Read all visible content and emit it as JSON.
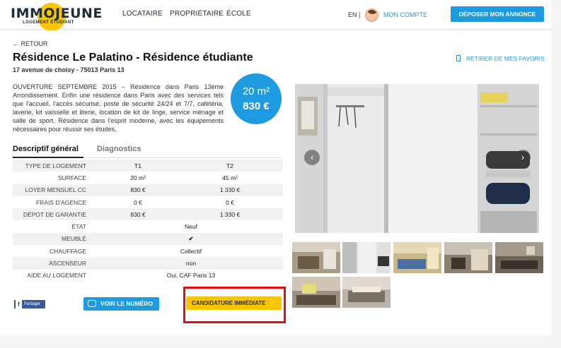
{
  "header": {
    "logo_text": "IMMOJEUNE",
    "logo_subtitle": "LOGEMENT ÉTUDIANT",
    "nav": [
      "LOCATAIRE",
      "PROPRIÉTAIRE",
      "ÉCOLE"
    ],
    "lang": "EN |",
    "account": "MON COMPTE",
    "deposit_button": "DÉPOSER MON ANNONCE"
  },
  "listing": {
    "back": "← RETOUR",
    "title": "Résidence Le Palatino - Résidence étudiante",
    "address": "17 avenue de choisy - 75013 Paris 13",
    "favorite": "RETIRER DE MES FAVORIS",
    "description": "OUVERTURE SEPTEMBRE 2015 – Résidence dans Paris 13ème Arrondissement. Enfin une résidence dans Paris avec des services tels que l'accueil, l'accès sécurisé, poste de sécurité 24/24 et 7/7, cafétéria, laverie, kit vaisselle et literie, location de kit de linge, service ménage et salle de sport. Résidence dans l'esprit moderne, avec les équipements nécessaires pour réussir ses études.",
    "price_area": "20 m²",
    "price_rent": "830 €"
  },
  "tabs": [
    "Descriptif général",
    "Diagnostics"
  ],
  "specs": {
    "type": {
      "label": "TYPE DE LOGEMENT",
      "t1": "T1",
      "t2": "T2"
    },
    "surface": {
      "label": "SURFACE",
      "t1": "20 m²",
      "t2": "45 m²"
    },
    "loyer": {
      "label": "LOYER MENSUEL CC",
      "t1": "830 €",
      "t2": "1 330 €"
    },
    "frais": {
      "label": "FRAIS D'AGENCE",
      "t1": "0 €",
      "t2": "0 €"
    },
    "depot": {
      "label": "DÉPOT DE GARANTIE",
      "t1": "830 €",
      "t2": "1 330 €"
    },
    "etat": {
      "label": "ÉTAT",
      "value": "Neuf"
    },
    "meuble": {
      "label": "MEUBLÉ",
      "value": "✔"
    },
    "chauffage": {
      "label": "CHAUFFAGE",
      "value": "Collectif"
    },
    "ascenseur": {
      "label": "ASCENSEUR",
      "value": "non"
    },
    "aide": {
      "label": "AIDE AU LOGEMENT",
      "value": "Oui, CAF Paris 13"
    }
  },
  "actions": {
    "share": "Partager",
    "call": "VOIR LE NUMÉRO",
    "apply": "CANDIDATURE IMMÉDIATE",
    "apply_icon": "⚡"
  },
  "gallery": {
    "prev_arrow": "‹",
    "next_arrow": "›",
    "main_photo_icon": "room-closet-photo"
  },
  "colors": {
    "accent": "#1e9be0",
    "brand_yellow": "#f7c600",
    "highlight": "#e01010"
  }
}
